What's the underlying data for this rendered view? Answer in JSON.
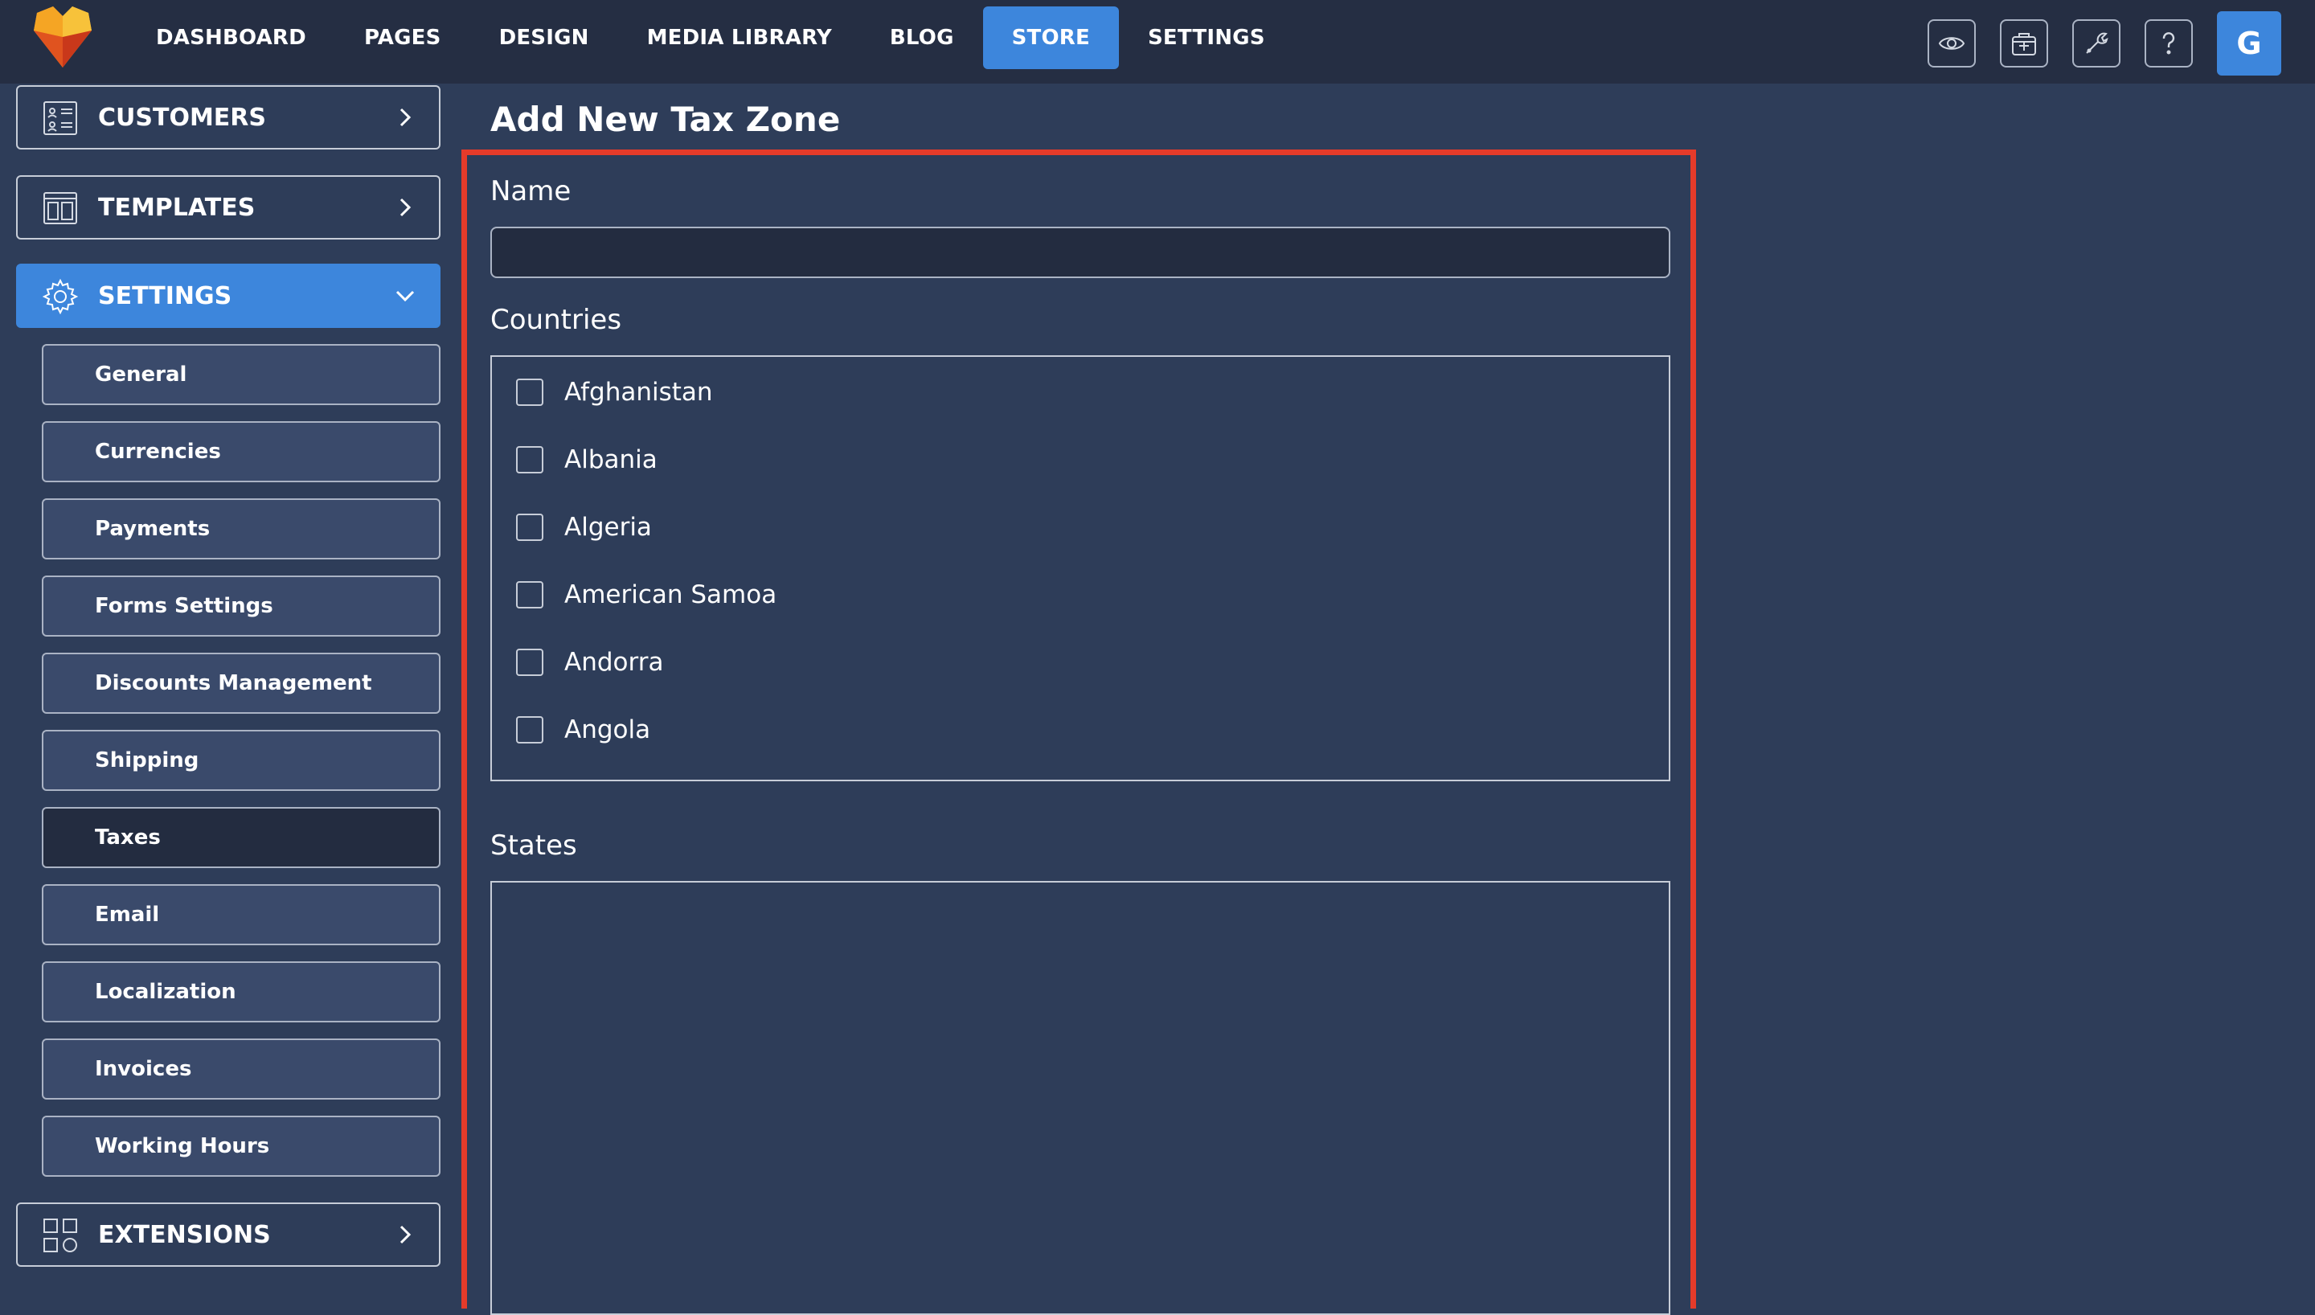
{
  "nav": {
    "items": [
      {
        "label": "DASHBOARD",
        "active": false
      },
      {
        "label": "PAGES",
        "active": false
      },
      {
        "label": "DESIGN",
        "active": false
      },
      {
        "label": "MEDIA LIBRARY",
        "active": false
      },
      {
        "label": "BLOG",
        "active": false
      },
      {
        "label": "STORE",
        "active": true
      },
      {
        "label": "SETTINGS",
        "active": false
      }
    ],
    "avatar_initial": "G",
    "tools": [
      "eye-icon",
      "briefcase-add-icon",
      "wrench-icon",
      "question-icon"
    ]
  },
  "sidebar": {
    "customers_label": "CUSTOMERS",
    "templates_label": "TEMPLATES",
    "settings_label": "SETTINGS",
    "extensions_label": "EXTENSIONS",
    "settings_items": [
      {
        "label": "General"
      },
      {
        "label": "Currencies"
      },
      {
        "label": "Payments"
      },
      {
        "label": "Forms Settings"
      },
      {
        "label": "Discounts Management"
      },
      {
        "label": "Shipping"
      },
      {
        "label": "Taxes",
        "active": true
      },
      {
        "label": "Email"
      },
      {
        "label": "Localization"
      },
      {
        "label": "Invoices"
      },
      {
        "label": "Working Hours"
      }
    ]
  },
  "main": {
    "title": "Add New Tax Zone",
    "name_label": "Name",
    "name_value": "",
    "countries_label": "Countries",
    "countries": [
      {
        "label": "Afghanistan",
        "checked": false
      },
      {
        "label": "Albania",
        "checked": false
      },
      {
        "label": "Algeria",
        "checked": false
      },
      {
        "label": "American Samoa",
        "checked": false
      },
      {
        "label": "Andorra",
        "checked": false
      },
      {
        "label": "Angola",
        "checked": false
      }
    ],
    "states_label": "States"
  },
  "colors": {
    "accent": "#3d86dc",
    "background": "#2e3d59",
    "topbar": "#252e43",
    "highlight": "#e53b2a"
  }
}
